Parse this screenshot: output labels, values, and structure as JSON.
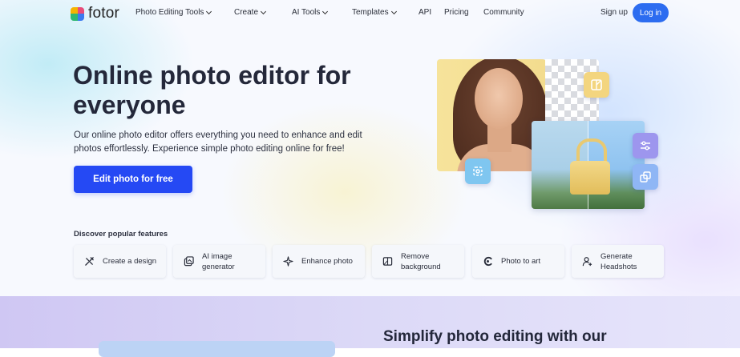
{
  "brand": {
    "name": "fotor"
  },
  "nav": {
    "items": [
      {
        "label": "Photo Editing Tools",
        "dropdown": true
      },
      {
        "label": "Create",
        "dropdown": true
      },
      {
        "label": "AI Tools",
        "dropdown": true
      },
      {
        "label": "Templates",
        "dropdown": true
      },
      {
        "label": "API",
        "dropdown": false
      },
      {
        "label": "Pricing",
        "dropdown": false
      },
      {
        "label": "Community",
        "dropdown": false
      }
    ],
    "signup_label": "Sign up",
    "login_label": "Log in"
  },
  "hero": {
    "headline": "Online photo editor for everyone",
    "subtext": "Our online photo editor offers everything you need to enhance and edit photos effortlessly. Experience simple photo editing online for free!",
    "cta_label": "Edit photo for free"
  },
  "features": {
    "heading": "Discover popular features",
    "items": [
      {
        "label": "Create a design",
        "icon": "magic-tools-icon"
      },
      {
        "label": "AI image generator",
        "icon": "ai-image-icon"
      },
      {
        "label": "Enhance photo",
        "icon": "enhance-sparkle-icon"
      },
      {
        "label": "Remove background",
        "icon": "remove-bg-icon"
      },
      {
        "label": "Photo to art",
        "icon": "art-c-icon"
      },
      {
        "label": "Generate Headshots",
        "icon": "headshot-person-icon"
      }
    ]
  },
  "collage_tools": [
    "layers-tool-icon",
    "sliders-tool-icon",
    "resize-tool-icon",
    "crop-tool-icon"
  ],
  "lower": {
    "title": "Simplify photo editing with our"
  },
  "colors": {
    "accent": "#2549f4",
    "login": "#2c6cf0"
  }
}
